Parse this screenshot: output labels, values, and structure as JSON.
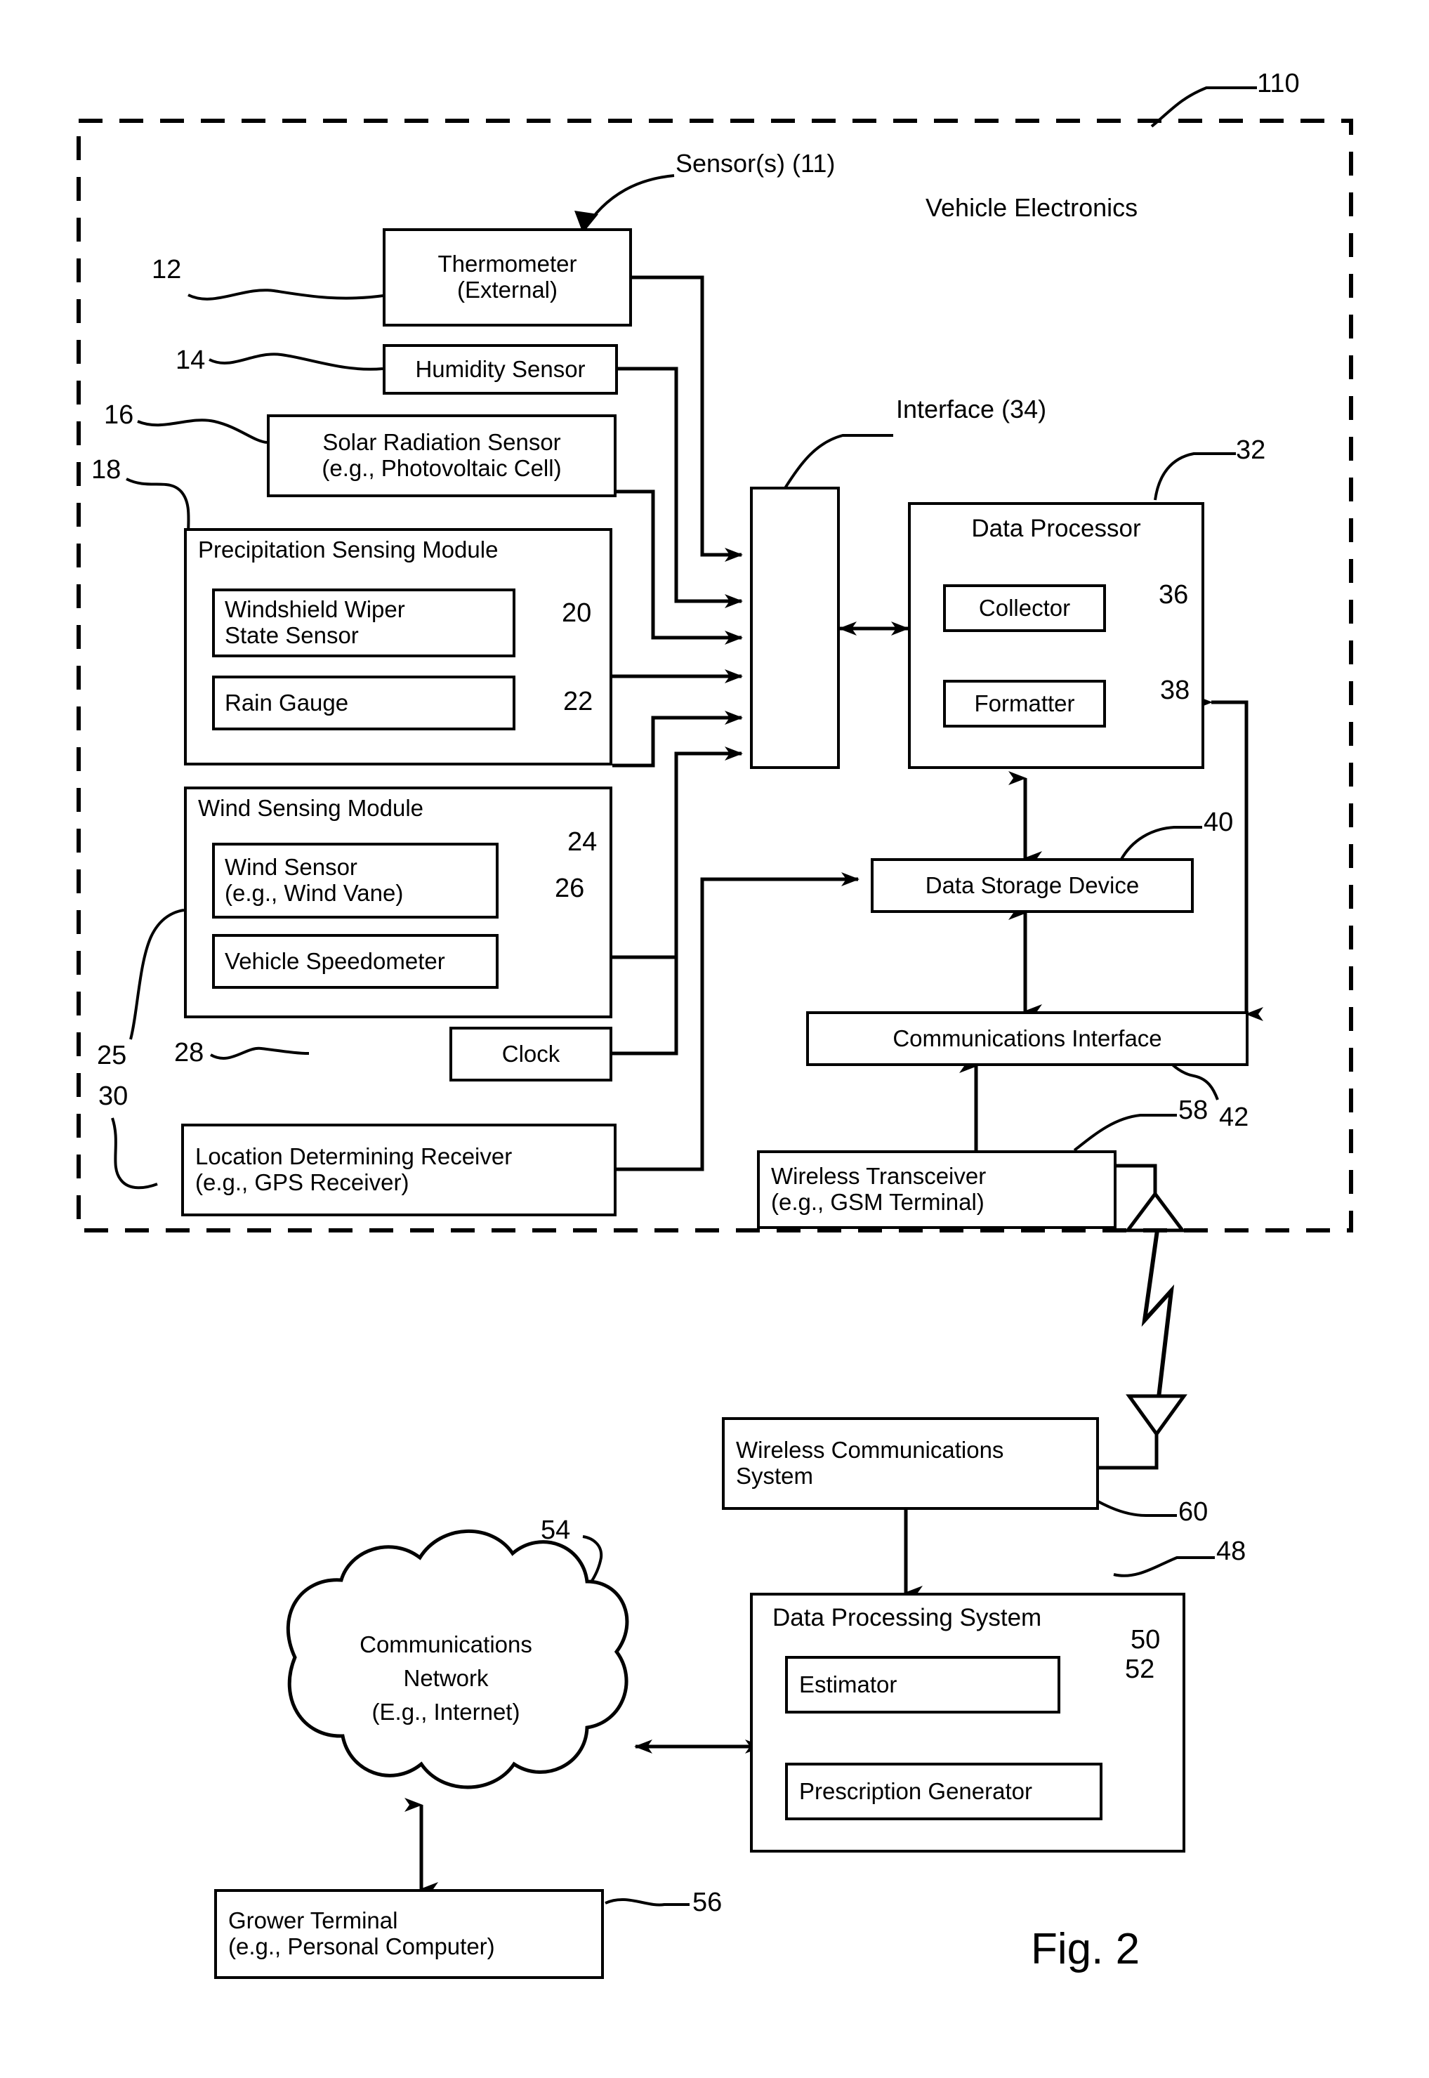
{
  "figure": {
    "caption": "Fig. 2",
    "system_ref": "110",
    "vehicle_electronics_label": "Vehicle Electronics",
    "sensors_label": "Sensor(s) (11)",
    "interface_label": "Interface (34)"
  },
  "blocks": {
    "thermometer": {
      "line1": "Thermometer",
      "line2": "(External)",
      "ref": "12"
    },
    "humidity": {
      "line1": "Humidity Sensor",
      "ref": "14"
    },
    "solar": {
      "line1": "Solar Radiation Sensor",
      "line2": "(e.g., Photovoltaic Cell)",
      "ref": "16"
    },
    "precipitation_module": {
      "title": "Precipitation Sensing Module",
      "ref": "18"
    },
    "wiper": {
      "line1": "Windshield Wiper",
      "line2": "State Sensor",
      "ref": "20"
    },
    "rain_gauge": {
      "line1": "Rain Gauge",
      "ref": "22"
    },
    "wind_module": {
      "title": "Wind Sensing Module",
      "ref": "25"
    },
    "wind_sensor": {
      "line1": "Wind Sensor",
      "line2": "(e.g., Wind Vane)",
      "ref": "24"
    },
    "speedometer": {
      "line1": "Vehicle Speedometer",
      "ref": "26"
    },
    "clock": {
      "line1": "Clock",
      "ref": "28"
    },
    "gps": {
      "line1": "Location Determining Receiver",
      "line2": "(e.g., GPS Receiver)",
      "ref": "30"
    },
    "interface": {
      "ref": "34"
    },
    "data_processor": {
      "title": "Data Processor",
      "ref": "32"
    },
    "collector": {
      "line1": "Collector",
      "ref": "36"
    },
    "formatter": {
      "line1": "Formatter",
      "ref": "38"
    },
    "data_storage": {
      "line1": "Data Storage Device",
      "ref": "40"
    },
    "comm_interface": {
      "line1": "Communications Interface",
      "ref": "42"
    },
    "wireless_transceiver": {
      "line1": "Wireless Transceiver",
      "line2": "(e.g., GSM Terminal)",
      "ref": "58"
    },
    "wireless_comm_system": {
      "line1": "Wireless Communications",
      "line2": "System",
      "ref": "60"
    },
    "data_processing_system": {
      "title": "Data Processing System",
      "ref": "48"
    },
    "estimator": {
      "line1": "Estimator",
      "ref": "50"
    },
    "prescription_generator": {
      "line1": "Prescription Generator",
      "ref": "52"
    },
    "comm_network": {
      "line1": "Communications",
      "line2": "Network",
      "line3": "(E.g., Internet)",
      "ref": "54"
    },
    "grower_terminal": {
      "line1": "Grower Terminal",
      "line2": "(e.g., Personal Computer)",
      "ref": "56"
    }
  },
  "icons": {
    "antenna_up": "antenna-up-icon",
    "antenna_down": "antenna-down-icon",
    "rf_link": "wireless-link-icon"
  },
  "colors": {
    "line": "#000000",
    "background": "#ffffff"
  }
}
